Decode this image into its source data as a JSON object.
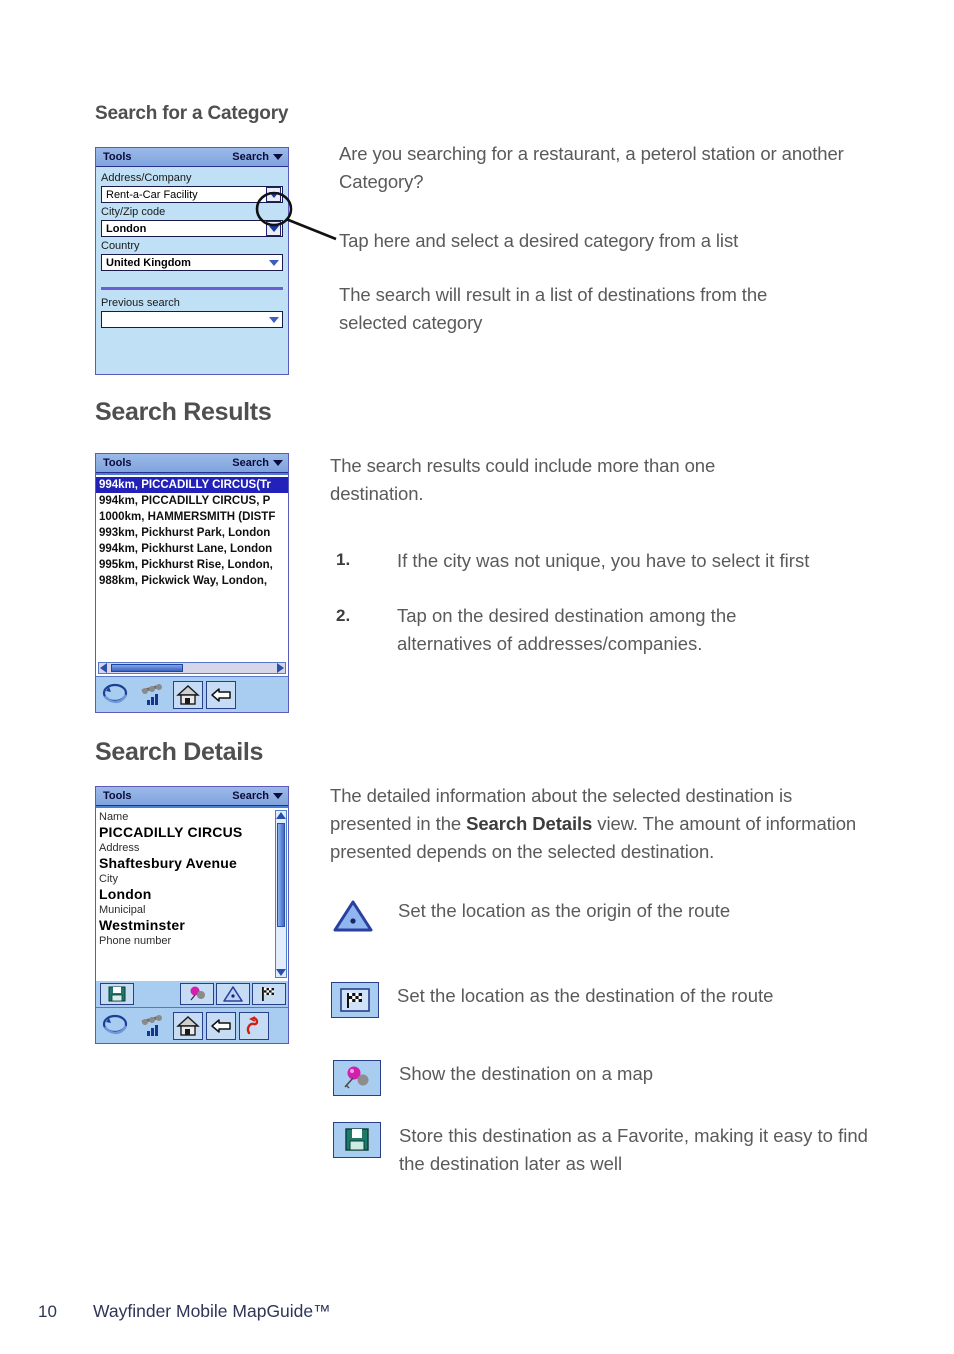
{
  "document": {
    "footer": {
      "page_number": "10",
      "title": "Wayfinder Mobile MapGuide™"
    }
  },
  "sections": [
    {
      "heading": "Search for a Category",
      "screen": {
        "title_bar": {
          "left_label": "Tools",
          "right_label": "Search",
          "right_icon": "chevron-down-icon"
        },
        "fields": [
          {
            "label": "Address/Company",
            "value": "Rent-a-Car Facility",
            "bold": false,
            "arrow_style": "button"
          },
          {
            "label": "City/Zip code",
            "value": "London",
            "bold": true,
            "arrow_style": "button"
          },
          {
            "label": "Country",
            "value": "United Kingdom",
            "bold": true,
            "arrow_style": "plain"
          }
        ],
        "previous": {
          "label": "Previous search",
          "value": "",
          "arrow_style": "plain"
        }
      },
      "paragraphs": [
        "Are you searching for a restaurant, a peterol station or another Category?",
        "Tap here and select a desired category from a list",
        "The search will result in a list of destinations from the selected category"
      ]
    },
    {
      "heading": "Search Results",
      "screen": {
        "title_bar": {
          "left_label": "Tools",
          "right_label": "Search",
          "right_icon": "chevron-down-icon"
        },
        "results": [
          {
            "text": "994km, PICCADILLY CIRCUS(Tr",
            "selected": true
          },
          {
            "text": "994km, PICCADILLY CIRCUS, P",
            "selected": false
          },
          {
            "text": "1000km, HAMMERSMITH (DISTF",
            "selected": false
          },
          {
            "text": "993km, Pickhurst Park, London",
            "selected": false
          },
          {
            "text": "994km, Pickhurst Lane, London",
            "selected": false
          },
          {
            "text": "995km, Pickhurst Rise, London,",
            "selected": false
          },
          {
            "text": "988km, Pickwick Way, London,",
            "selected": false
          }
        ],
        "toolbar": [
          "globe-route-icon",
          "gps-signal-icon",
          "home-icon",
          "back-arrow-icon"
        ]
      },
      "intro": "The search results could include more than one destination.",
      "steps": [
        {
          "num": "1.",
          "text": "If the city was not unique, you have to select it first"
        },
        {
          "num": "2.",
          "text": "Tap on the desired destination among the alternatives of addresses/companies."
        }
      ]
    },
    {
      "heading": "Search Details",
      "screen": {
        "title_bar": {
          "left_label": "Tools",
          "right_label": "Search",
          "right_icon": "chevron-down-icon"
        },
        "details": [
          {
            "label": "Name",
            "value": "PICCADILLY CIRCUS"
          },
          {
            "label": "Address",
            "value": "Shaftesbury Avenue"
          },
          {
            "label": "City",
            "value": "London"
          },
          {
            "label": "Municipal",
            "value": "Westminster"
          },
          {
            "label": "Phone number",
            "value": ""
          }
        ],
        "toolbar_top": [
          "save-floppy-icon",
          "map-pin-icon",
          "origin-triangle-icon",
          "destination-flag-icon"
        ],
        "toolbar_bottom": [
          "globe-route-icon",
          "gps-signal-icon",
          "home-icon",
          "back-arrow-icon",
          "reroute-icon"
        ]
      },
      "paragraph_parts": {
        "a": "The detailed information about the selected destination is presented in the ",
        "b": "Search Details",
        "c": " view. The amount of information presented depends on the selected destination."
      },
      "legend": [
        {
          "icon": "origin-triangle-icon",
          "boxed": false,
          "text": "Set the location as the origin of the route"
        },
        {
          "icon": "destination-flag-icon",
          "boxed": true,
          "text": "Set the location as the destination of the route"
        },
        {
          "icon": "map-pin-icon",
          "boxed": true,
          "text": "Show the destination on a map"
        },
        {
          "icon": "save-floppy-icon",
          "boxed": true,
          "text": "Store this destination as a Favorite, making it easy to find the destination later as well"
        }
      ]
    }
  ],
  "colors": {
    "heading": "#4f4f4f",
    "body": "#5a5a5a",
    "pda_titlebar": "#8fb0e4",
    "pda_form_bg": "#bfe0f5",
    "pda_toolbar": "#a8cdf0",
    "selection": "#2222bb",
    "divider": "#6a5fd0",
    "footer": "#2e3556"
  }
}
